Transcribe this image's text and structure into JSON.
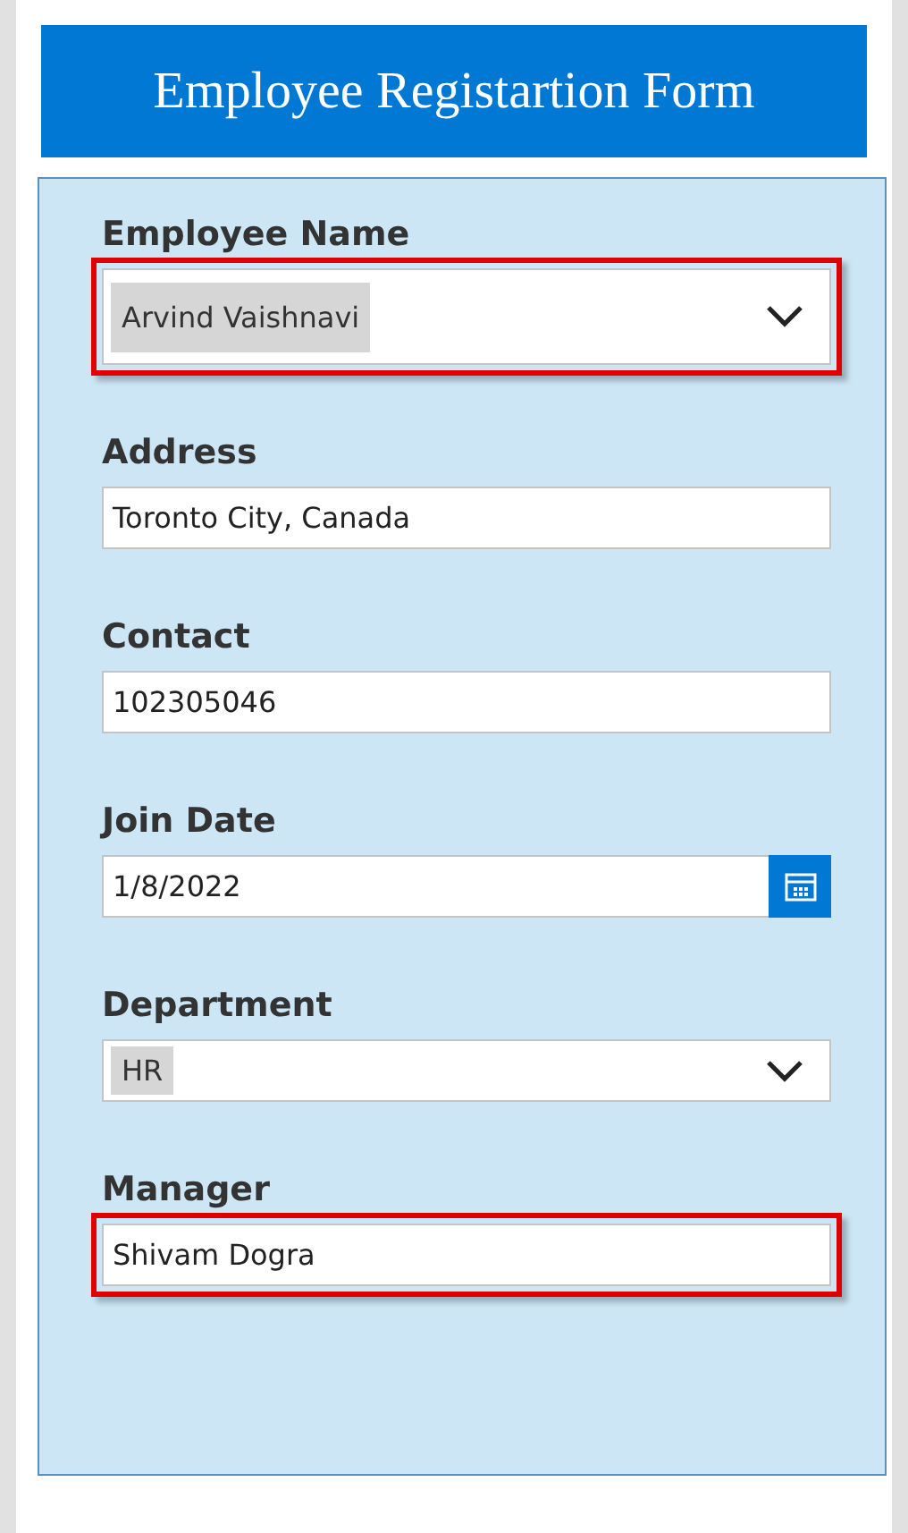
{
  "header": {
    "title": "Employee Registartion Form"
  },
  "fields": [
    {
      "label": "Employee Name",
      "kind": "dropdown",
      "value": "Arvind Vaishnavi",
      "highlighted": true
    },
    {
      "label": "Address",
      "kind": "text",
      "value": "Toronto City, Canada",
      "highlighted": false
    },
    {
      "label": "Contact",
      "kind": "text",
      "value": "102305046",
      "highlighted": false
    },
    {
      "label": "Join Date",
      "kind": "date",
      "value": "1/8/2022",
      "highlighted": false
    },
    {
      "label": "Department",
      "kind": "dropdown",
      "value": "HR",
      "highlighted": false
    },
    {
      "label": "Manager",
      "kind": "text",
      "value": "Shivam Dogra",
      "highlighted": true
    }
  ]
}
